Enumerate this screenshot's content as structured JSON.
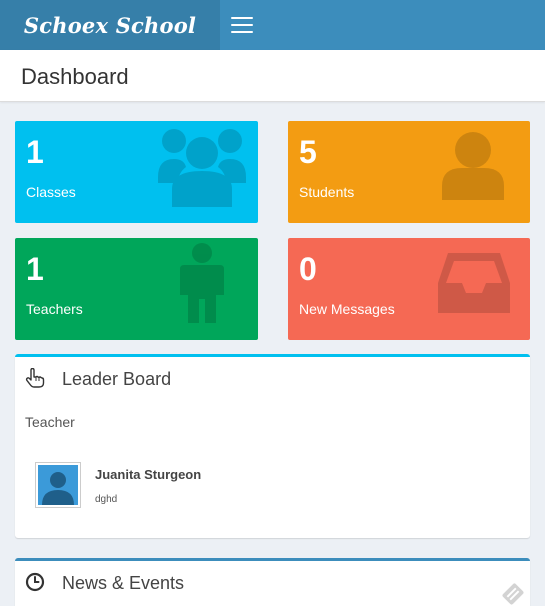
{
  "app": {
    "logo_text": "Schoex School"
  },
  "header": {
    "page_title": "Dashboard"
  },
  "tiles": [
    {
      "value": "1",
      "label": "Classes",
      "icon": "users-icon",
      "color": "#00c0ef"
    },
    {
      "value": "5",
      "label": "Students",
      "icon": "user-icon",
      "color": "#f39c12"
    },
    {
      "value": "1",
      "label": "Teachers",
      "icon": "male-icon",
      "color": "#00a65a"
    },
    {
      "value": "0",
      "label": "New Messages",
      "icon": "inbox-icon",
      "color": "#f56954"
    }
  ],
  "leader_board": {
    "title": "Leader Board",
    "icon": "hand-pointer-icon",
    "section_label": "Teacher",
    "entries": [
      {
        "name": "Juanita Sturgeon",
        "subtitle": "dghd",
        "avatar": "avatar-icon"
      }
    ]
  },
  "news": {
    "title": "News & Events",
    "icon": "clock-icon"
  }
}
